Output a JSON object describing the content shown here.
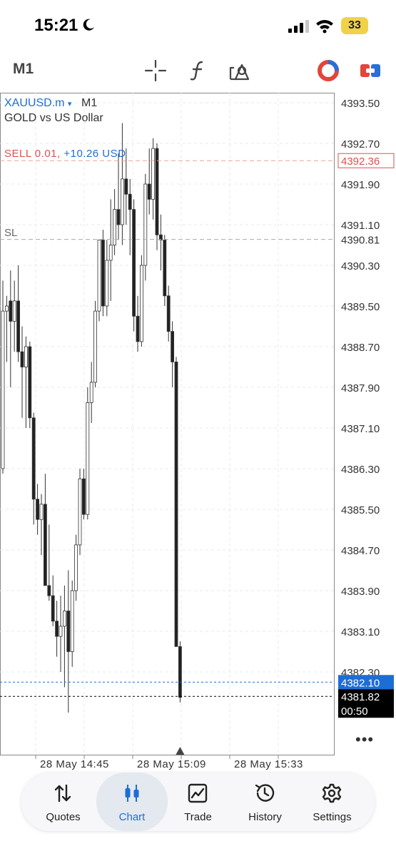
{
  "status_bar": {
    "time": "15:21",
    "battery": "33"
  },
  "toolbar": {
    "timeframe": "M1"
  },
  "chart_header": {
    "symbol": "XAUUSD.m",
    "symbol_arrow": "▾",
    "timeframe": "M1",
    "description": "GOLD vs US Dollar"
  },
  "position": {
    "label": "SELL 0.01,",
    "profit": "+10.26 USD",
    "price": "4392.36"
  },
  "stop_loss": {
    "label": "SL",
    "price": "4390.81"
  },
  "price_axis": [
    "4393.50",
    "4392.70",
    "4391.90",
    "4391.10",
    "4390.30",
    "4389.50",
    "4388.70",
    "4387.90",
    "4387.10",
    "4386.30",
    "4385.50",
    "4384.70",
    "4383.90",
    "4383.10",
    "4382.30"
  ],
  "bid": {
    "price": "4382.10",
    "color": "#1c6ed6"
  },
  "last": {
    "price": "4381.82",
    "countdown": "00:50"
  },
  "time_axis": [
    "28 May 14:45",
    "28 May 15:09",
    "28 May 15:33"
  ],
  "more": "•••",
  "nav": [
    {
      "label": "Quotes",
      "icon": "arrows-updown-icon"
    },
    {
      "label": "Chart",
      "icon": "candles-icon"
    },
    {
      "label": "Trade",
      "icon": "trend-line-icon"
    },
    {
      "label": "History",
      "icon": "clock-history-icon"
    },
    {
      "label": "Settings",
      "icon": "gear-icon"
    }
  ],
  "colors": {
    "accent": "#1c6ed6",
    "sell": "#d9534f",
    "bear": "#222222",
    "bull": "#ffffff"
  },
  "chart_data": {
    "type": "candlestick",
    "ylim": [
      4381.7,
      4393.6
    ],
    "candles": [
      {
        "o": 4386.3,
        "h": 4390.0,
        "l": 4386.2,
        "c": 4389.4
      },
      {
        "o": 4389.4,
        "h": 4389.7,
        "l": 4388.4,
        "c": 4389.5
      },
      {
        "o": 4389.6,
        "h": 4390.2,
        "l": 4387.9,
        "c": 4389.2
      },
      {
        "o": 4389.2,
        "h": 4390.0,
        "l": 4388.6,
        "c": 4389.6
      },
      {
        "o": 4389.6,
        "h": 4390.3,
        "l": 4388.4,
        "c": 4388.6
      },
      {
        "o": 4388.6,
        "h": 4389.1,
        "l": 4387.3,
        "c": 4388.3
      },
      {
        "o": 4388.3,
        "h": 4388.9,
        "l": 4387.1,
        "c": 4388.7
      },
      {
        "o": 4388.7,
        "h": 4388.8,
        "l": 4387.1,
        "c": 4387.3
      },
      {
        "o": 4387.3,
        "h": 4387.4,
        "l": 4385.2,
        "c": 4385.7
      },
      {
        "o": 4385.7,
        "h": 4386.0,
        "l": 4385.0,
        "c": 4385.3
      },
      {
        "o": 4385.3,
        "h": 4385.8,
        "l": 4384.6,
        "c": 4385.6
      },
      {
        "o": 4385.6,
        "h": 4386.2,
        "l": 4384.0,
        "c": 4384.0
      },
      {
        "o": 4384.0,
        "h": 4385.2,
        "l": 4383.7,
        "c": 4383.8
      },
      {
        "o": 4383.8,
        "h": 4384.2,
        "l": 4383.2,
        "c": 4383.3
      },
      {
        "o": 4383.3,
        "h": 4383.7,
        "l": 4382.6,
        "c": 4383.0
      },
      {
        "o": 4383.0,
        "h": 4383.8,
        "l": 4382.3,
        "c": 4383.2
      },
      {
        "o": 4383.2,
        "h": 4384.0,
        "l": 4382.0,
        "c": 4383.5
      },
      {
        "o": 4383.5,
        "h": 4384.3,
        "l": 4381.5,
        "c": 4382.7
      },
      {
        "o": 4382.7,
        "h": 4384.1,
        "l": 4382.4,
        "c": 4383.9
      },
      {
        "o": 4383.9,
        "h": 4385.0,
        "l": 4383.7,
        "c": 4384.8
      },
      {
        "o": 4384.8,
        "h": 4386.3,
        "l": 4384.6,
        "c": 4386.1
      },
      {
        "o": 4386.1,
        "h": 4386.3,
        "l": 4385.3,
        "c": 4385.4
      },
      {
        "o": 4385.4,
        "h": 4387.9,
        "l": 4385.3,
        "c": 4387.6
      },
      {
        "o": 4387.6,
        "h": 4388.4,
        "l": 4387.2,
        "c": 4388.0
      },
      {
        "o": 4388.0,
        "h": 4389.6,
        "l": 4387.9,
        "c": 4389.4
      },
      {
        "o": 4389.4,
        "h": 4390.8,
        "l": 4389.2,
        "c": 4390.8
      },
      {
        "o": 4390.8,
        "h": 4391.0,
        "l": 4389.3,
        "c": 4389.5
      },
      {
        "o": 4389.5,
        "h": 4390.8,
        "l": 4389.3,
        "c": 4390.4
      },
      {
        "o": 4390.4,
        "h": 4391.6,
        "l": 4389.6,
        "c": 4390.7
      },
      {
        "o": 4390.7,
        "h": 4391.8,
        "l": 4390.5,
        "c": 4391.4
      },
      {
        "o": 4391.4,
        "h": 4392.5,
        "l": 4390.8,
        "c": 4391.1
      },
      {
        "o": 4391.1,
        "h": 4393.1,
        "l": 4390.7,
        "c": 4392.0
      },
      {
        "o": 4392.0,
        "h": 4392.6,
        "l": 4391.1,
        "c": 4391.7
      },
      {
        "o": 4391.7,
        "h": 4392.0,
        "l": 4390.5,
        "c": 4391.4
      },
      {
        "o": 4391.4,
        "h": 4391.6,
        "l": 4389.0,
        "c": 4389.3
      },
      {
        "o": 4389.3,
        "h": 4389.7,
        "l": 4388.6,
        "c": 4388.8
      },
      {
        "o": 4388.8,
        "h": 4390.5,
        "l": 4388.7,
        "c": 4390.3
      },
      {
        "o": 4390.3,
        "h": 4392.1,
        "l": 4390.0,
        "c": 4391.9
      },
      {
        "o": 4391.9,
        "h": 4392.6,
        "l": 4391.3,
        "c": 4391.6
      },
      {
        "o": 4391.6,
        "h": 4392.8,
        "l": 4391.2,
        "c": 4392.6
      },
      {
        "o": 4392.6,
        "h": 4392.7,
        "l": 4390.6,
        "c": 4390.9
      },
      {
        "o": 4390.9,
        "h": 4391.3,
        "l": 4390.2,
        "c": 4390.8
      },
      {
        "o": 4390.8,
        "h": 4390.9,
        "l": 4389.5,
        "c": 4389.7
      },
      {
        "o": 4389.7,
        "h": 4389.9,
        "l": 4388.8,
        "c": 4389.0
      },
      {
        "o": 4389.0,
        "h": 4389.2,
        "l": 4387.9,
        "c": 4388.4
      },
      {
        "o": 4388.4,
        "h": 4388.5,
        "l": 4382.8,
        "c": 4382.8
      },
      {
        "o": 4382.8,
        "h": 4382.9,
        "l": 4381.7,
        "c": 4381.8
      }
    ]
  }
}
